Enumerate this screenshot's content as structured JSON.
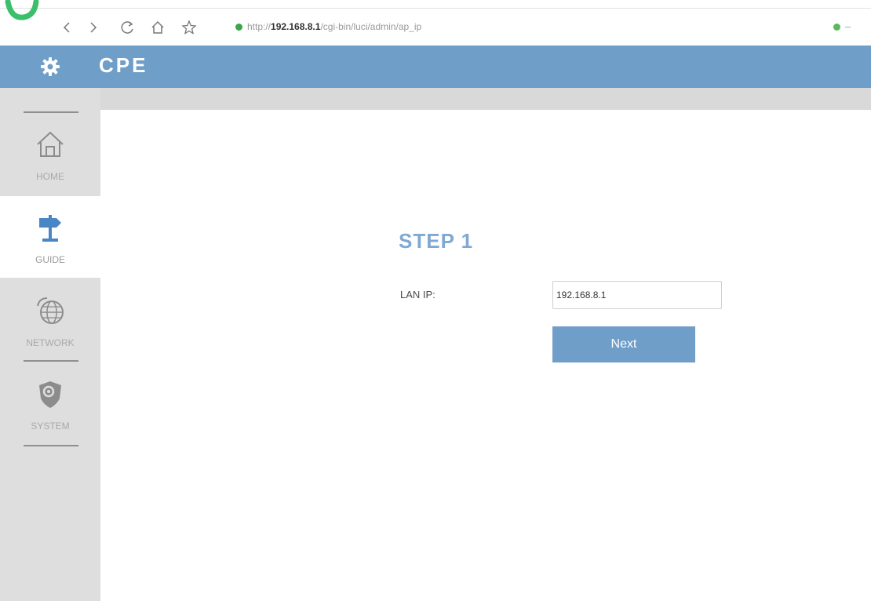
{
  "browser": {
    "url_prefix": "http://",
    "url_host": "192.168.8.1",
    "url_path": "/cgi-bin/luci/admin/ap_ip"
  },
  "header": {
    "title": "CPE"
  },
  "sidebar": {
    "items": [
      {
        "key": "home",
        "label": "HOME",
        "icon": "home-icon",
        "active": false
      },
      {
        "key": "guide",
        "label": "GUIDE",
        "icon": "signpost-icon",
        "active": true
      },
      {
        "key": "network",
        "label": "NETWORK",
        "icon": "globe-icon",
        "active": false
      },
      {
        "key": "system",
        "label": "SYSTEM",
        "icon": "shield-gear-icon",
        "active": false
      }
    ]
  },
  "main": {
    "step_title": "STEP 1",
    "lan_ip_label": "LAN IP:",
    "lan_ip_value": "192.168.8.1",
    "next_label": "Next"
  },
  "colors": {
    "header_bg": "#6f9ec9",
    "accent": "#7fa9d2",
    "sidebar_bg": "#dedede",
    "secure": "#3aa54a"
  }
}
